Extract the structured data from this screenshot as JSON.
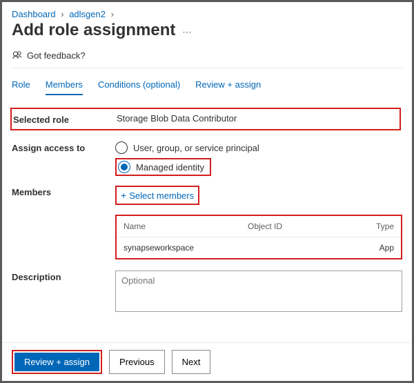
{
  "breadcrumb": {
    "item1": "Dashboard",
    "item2": "adlsgen2"
  },
  "title": "Add role assignment",
  "feedback": "Got feedback?",
  "tabs": {
    "role": "Role",
    "members": "Members",
    "conditions": "Conditions (optional)",
    "review": "Review + assign"
  },
  "labels": {
    "selected_role": "Selected role",
    "assign_access_to": "Assign access to",
    "members": "Members",
    "description": "Description"
  },
  "selected_role_value": "Storage Blob Data Contributor",
  "radio": {
    "user_group_sp": "User, group, or service principal",
    "managed_identity": "Managed identity"
  },
  "select_members": "Select members",
  "table": {
    "headers": {
      "name": "Name",
      "object_id": "Object ID",
      "type": "Type"
    },
    "rows": [
      {
        "name": "synapseworkspace",
        "object_id": "",
        "type": "App"
      }
    ]
  },
  "description_placeholder": "Optional",
  "buttons": {
    "review_assign": "Review + assign",
    "previous": "Previous",
    "next": "Next"
  }
}
